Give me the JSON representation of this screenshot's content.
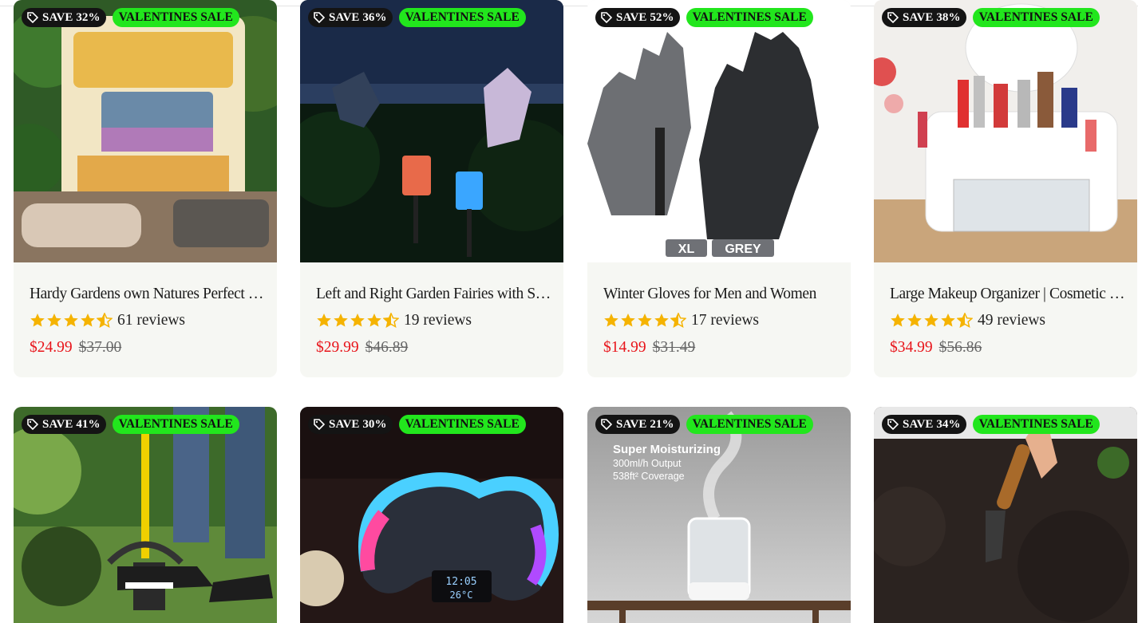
{
  "colors": {
    "sale_badge": "#22e61d",
    "save_badge": "#141414",
    "price": "#e8141a"
  },
  "products": [
    {
      "save": "SAVE 32%",
      "sale": "VALENTINES SALE",
      "title": "Hardy Gardens own Natures Perfect Soil Enhancement",
      "rating": 4.5,
      "reviews": "61 reviews",
      "price": "$24.99",
      "old_price": "$37.00",
      "image": "soil-bag-photo"
    },
    {
      "save": "SAVE 36%",
      "sale": "VALENTINES SALE",
      "title": "Left and Right Garden Fairies with Solar Lanterns",
      "rating": 4.5,
      "reviews": "19 reviews",
      "price": "$29.99",
      "old_price": "$46.89",
      "image": "garden-fairies-photo"
    },
    {
      "save": "SAVE 52%",
      "sale": "VALENTINES SALE",
      "title": "Winter Gloves for Men and Women",
      "rating": 4.5,
      "reviews": "17 reviews",
      "price": "$14.99",
      "old_price": "$31.49",
      "image": "gloves-photo",
      "size_label": "XL",
      "color_label": "GREY"
    },
    {
      "save": "SAVE 38%",
      "sale": "VALENTINES SALE",
      "title": "Large Makeup Organizer | Cosmetic Storage Box",
      "rating": 4.5,
      "reviews": "49 reviews",
      "price": "$34.99",
      "old_price": "$56.86",
      "image": "makeup-organizer-photo"
    },
    {
      "save": "SAVE 41%",
      "sale": "VALENTINES SALE",
      "image": "garden-tool-photo"
    },
    {
      "save": "SAVE 30%",
      "sale": "VALENTINES SALE",
      "image": "lamp-clock-photo",
      "clock_time": "12:05",
      "clock_temp": "26°C"
    },
    {
      "save": "SAVE 21%",
      "sale": "VALENTINES SALE",
      "image": "humidifier-photo",
      "caption_1": "Super Moisturizing",
      "caption_2": "300ml/h Output",
      "caption_3": "538ft² Coverage"
    },
    {
      "save": "SAVE 34%",
      "sale": "VALENTINES SALE",
      "image": "trowel-soil-photo"
    }
  ]
}
